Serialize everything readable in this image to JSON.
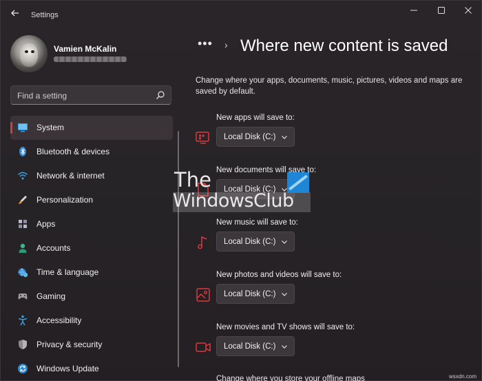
{
  "window": {
    "title": "Settings",
    "back_icon": "arrow-left-icon",
    "controls": [
      "minimize-icon",
      "maximize-icon",
      "close-icon"
    ]
  },
  "user": {
    "name": "Vamien McKalin"
  },
  "search": {
    "placeholder": "Find a setting"
  },
  "sidebar": {
    "items": [
      {
        "label": "System",
        "icon": "monitor-icon",
        "selected": true
      },
      {
        "label": "Bluetooth & devices",
        "icon": "bluetooth-icon"
      },
      {
        "label": "Network & internet",
        "icon": "wifi-icon"
      },
      {
        "label": "Personalization",
        "icon": "brush-icon"
      },
      {
        "label": "Apps",
        "icon": "apps-icon"
      },
      {
        "label": "Accounts",
        "icon": "person-icon"
      },
      {
        "label": "Time & language",
        "icon": "globe-clock-icon"
      },
      {
        "label": "Gaming",
        "icon": "gamepad-icon"
      },
      {
        "label": "Accessibility",
        "icon": "accessibility-icon"
      },
      {
        "label": "Privacy & security",
        "icon": "shield-icon"
      },
      {
        "label": "Windows Update",
        "icon": "sync-icon"
      }
    ]
  },
  "main": {
    "breadcrumb_more": "•••",
    "breadcrumb_sep": "›",
    "title": "Where new content is saved",
    "description": "Change where your apps, documents, music, pictures, videos and maps are saved by default.",
    "settings": [
      {
        "label": "New apps will save to:",
        "value": "Local Disk (C:)",
        "icon": "apps-save-icon"
      },
      {
        "label": "New documents will save to:",
        "value": "Local Disk (C:)",
        "icon": "document-icon"
      },
      {
        "label": "New music will save to:",
        "value": "Local Disk (C:)",
        "icon": "music-note-icon"
      },
      {
        "label": "New photos and videos will save to:",
        "value": "Local Disk (C:)",
        "icon": "photo-icon"
      },
      {
        "label": "New movies and TV shows will save to:",
        "value": "Local Disk (C:)",
        "icon": "video-camera-icon"
      }
    ],
    "footer_partial": "Change where you store your offline maps"
  },
  "watermark": {
    "line1": "The",
    "line2": "WindowsClub"
  },
  "source_label": "wsxdn.com",
  "colors": {
    "accent": "#e0373c",
    "background": "#272429",
    "blue_icon": "#3a9bd8"
  }
}
